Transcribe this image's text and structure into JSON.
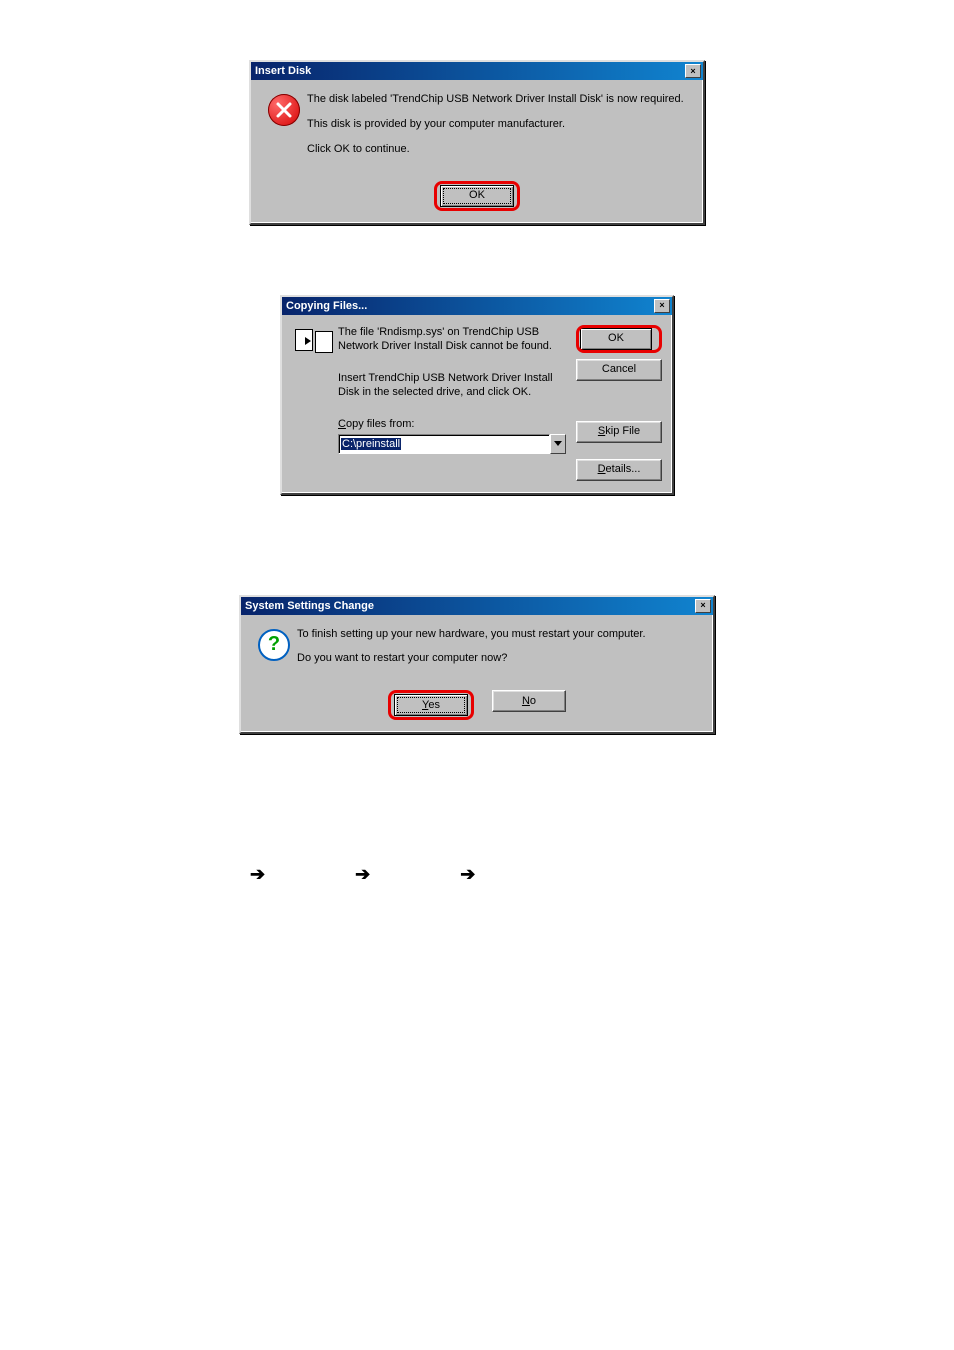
{
  "dialog1": {
    "title": "Insert Disk",
    "lines": [
      "The disk labeled 'TrendChip USB Network Driver Install Disk' is now required.",
      "This disk is provided by your computer manufacturer.",
      "Click OK to continue."
    ],
    "ok": "OK",
    "close": "×"
  },
  "dialog2": {
    "title": "Copying Files...",
    "msg1": "The file 'Rndismp.sys' on TrendChip USB Network Driver Install Disk cannot be found.",
    "msg2": "Insert TrendChip USB Network Driver Install Disk in the selected drive, and click OK.",
    "copy_label": "Copy files from:",
    "path": "C:\\preinstall",
    "buttons": {
      "ok": "OK",
      "cancel": "Cancel",
      "skip": "Skip File",
      "details": "Details..."
    },
    "close": "×"
  },
  "dialog3": {
    "title": "System Settings Change",
    "msg1": "To finish setting up your new hardware, you must restart your computer.",
    "msg2": "Do you want to restart your computer now?",
    "yes": "Yes",
    "no": "No",
    "close": "×"
  },
  "arrows": {
    "glyph": "➔"
  }
}
